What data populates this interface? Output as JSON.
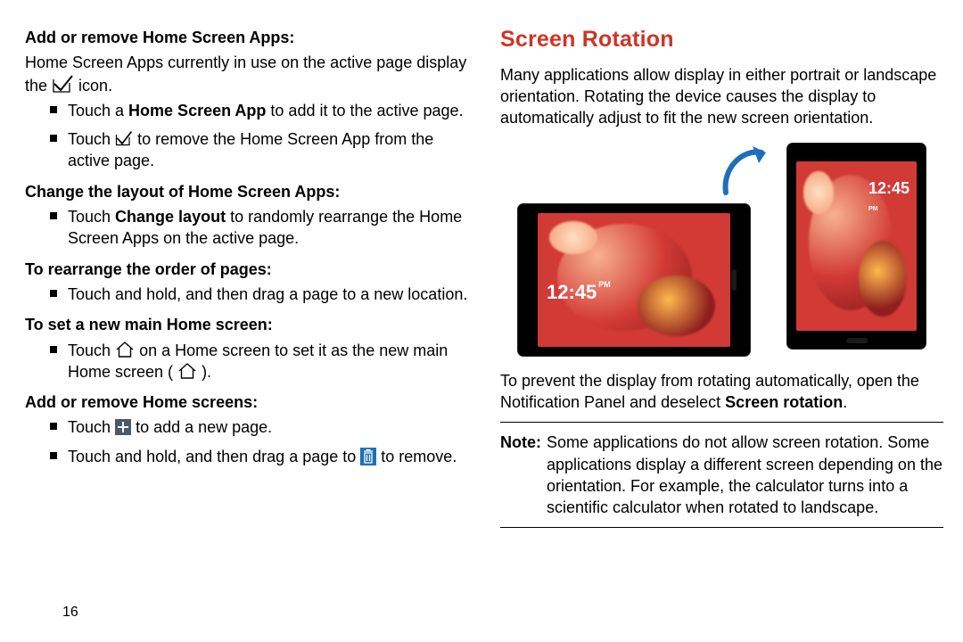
{
  "page_number": "16",
  "left": {
    "sub1": "Add or remove Home Screen Apps:",
    "intro_a": "Home Screen Apps currently in use on the active page display the ",
    "intro_b": " icon.",
    "li1_a": "Touch a ",
    "li1_bold": "Home Screen App",
    "li1_b": " to add it to the active page.",
    "li2_a": "Touch ",
    "li2_b": " to remove the Home Screen App from the active page.",
    "sub2": "Change the layout of Home Screen Apps:",
    "li3_a": "Touch ",
    "li3_bold": "Change layout",
    "li3_b": " to randomly rearrange the Home Screen Apps on the active page.",
    "sub3": "To rearrange the order of pages:",
    "li4": "Touch and hold, and then drag a page to a new location.",
    "sub4": "To set a new main Home screen:",
    "li5_a": "Touch ",
    "li5_b": " on a Home screen to set it as the new main Home screen ( ",
    "li5_c": " ).",
    "sub5": "Add or remove Home screens:",
    "li6_a": "Touch ",
    "li6_b": " to add a new page.",
    "li7_a": "Touch and hold, and then drag a page to ",
    "li7_b": " to remove."
  },
  "right": {
    "heading": "Screen Rotation",
    "p1": "Many applications allow display in either portrait or landscape orientation. Rotating the device causes the display to automatically adjust to fit the new screen orientation.",
    "clock_land": "12:45",
    "clock_land_ampm": "PM",
    "clock_port": "12:45",
    "clock_port_ampm": "PM",
    "p2_a": "To prevent the display from rotating automatically, open the Notification Panel and deselect ",
    "p2_bold": "Screen rotation",
    "p2_b": ".",
    "note_label": "Note:",
    "note_body": " Some applications do not allow screen rotation. Some applications display a different screen depending on the orientation. For example, the calculator turns into a scientific calculator when rotated to landscape."
  }
}
